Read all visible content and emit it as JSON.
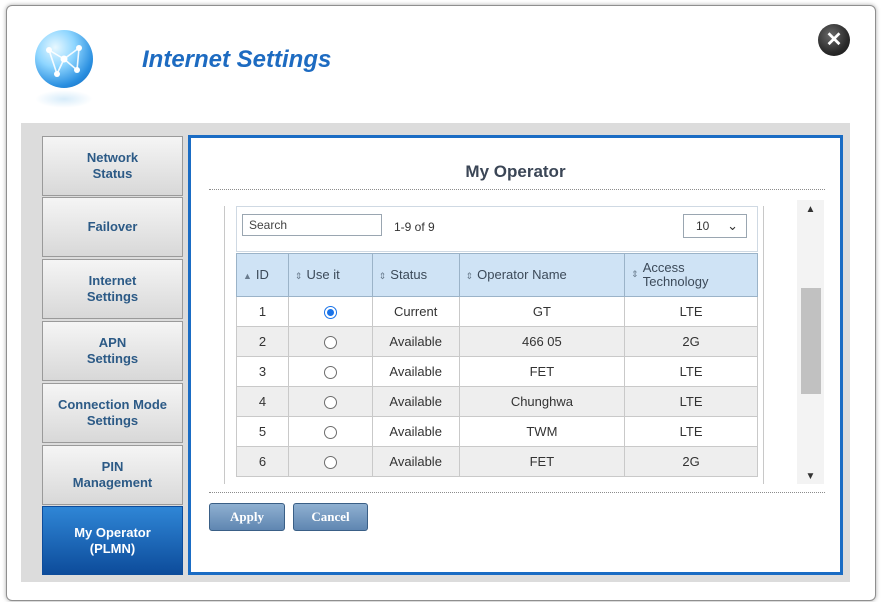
{
  "window": {
    "title": "Internet Settings",
    "close_label": "✕"
  },
  "sidebar": {
    "items": [
      {
        "label": "Network\nStatus",
        "active": false
      },
      {
        "label": "Failover",
        "active": false
      },
      {
        "label": "Internet\nSettings",
        "active": false
      },
      {
        "label": "APN\nSettings",
        "active": false
      },
      {
        "label": "Connection Mode\nSettings",
        "active": false
      },
      {
        "label": "PIN\nManagement",
        "active": false
      },
      {
        "label": "My Operator\n(PLMN)",
        "active": true
      }
    ]
  },
  "main": {
    "title": "My Operator",
    "search": {
      "placeholder": "Search"
    },
    "count": "1-9 of 9",
    "page_size": "10",
    "columns": [
      "ID",
      "Use it",
      "Status",
      "Operator Name",
      "Access\nTechnology"
    ],
    "sort_indicators": [
      "▲",
      "⇕",
      "⇕",
      "⇕",
      "⇕"
    ],
    "rows": [
      {
        "id": "1",
        "use": true,
        "status": "Current",
        "operator": "GT",
        "tech": "LTE"
      },
      {
        "id": "2",
        "use": false,
        "status": "Available",
        "operator": "466 05",
        "tech": "2G"
      },
      {
        "id": "3",
        "use": false,
        "status": "Available",
        "operator": "FET",
        "tech": "LTE"
      },
      {
        "id": "4",
        "use": false,
        "status": "Available",
        "operator": "Chunghwa",
        "tech": "LTE"
      },
      {
        "id": "5",
        "use": false,
        "status": "Available",
        "operator": "TWM",
        "tech": "LTE"
      },
      {
        "id": "6",
        "use": false,
        "status": "Available",
        "operator": "FET",
        "tech": "2G"
      }
    ],
    "buttons": {
      "apply": "Apply",
      "cancel": "Cancel"
    }
  },
  "colors": {
    "accent": "#1a6cc4",
    "title": "#1d6bc1",
    "active_nav": "#0d4c9b",
    "header_bg": "#cfe3f5"
  }
}
